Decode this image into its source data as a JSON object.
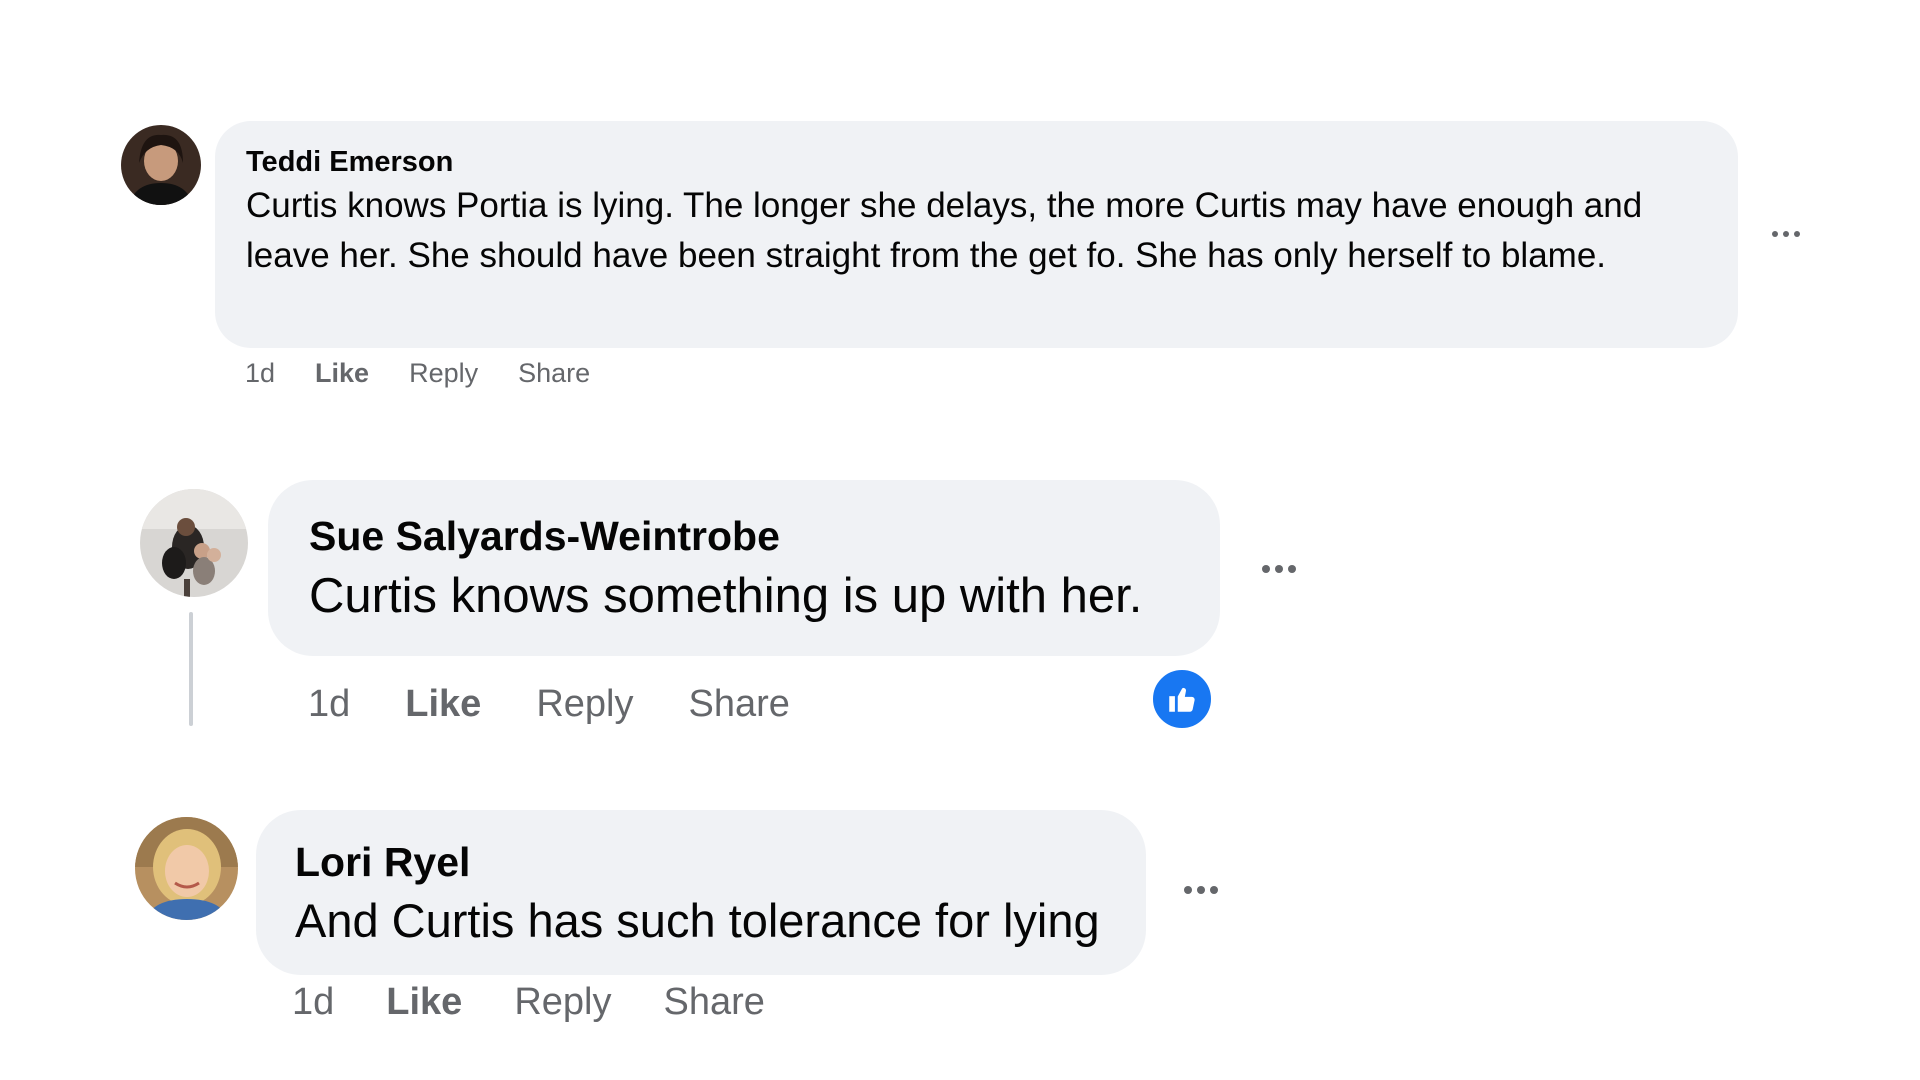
{
  "comments": [
    {
      "author": "Teddi Emerson",
      "text": "Curtis knows Portia is lying. The longer she delays, the more Curtis may have enough and leave her. She should have been straight from the get fo. She has only herself to blame.",
      "time": "1d",
      "like_label": "Like",
      "reply_label": "Reply",
      "share_label": "Share",
      "avatar_icon": "avatar-photo-icon",
      "more_icon": "more-options-icon"
    },
    {
      "author": "Sue Salyards-Weintrobe",
      "text": "Curtis knows something is up with her.",
      "time": "1d",
      "like_label": "Like",
      "reply_label": "Reply",
      "share_label": "Share",
      "avatar_icon": "avatar-photo-icon",
      "more_icon": "more-options-icon",
      "reaction_icon": "thumbs-up-icon"
    },
    {
      "author": "Lori Ryel",
      "text": "And Curtis has such tolerance for lying",
      "time": "1d",
      "like_label": "Like",
      "reply_label": "Reply",
      "share_label": "Share",
      "avatar_icon": "avatar-photo-icon",
      "more_icon": "more-options-icon"
    }
  ],
  "colors": {
    "bubble_background": "#f0f2f5",
    "secondary_text": "#65676b",
    "reaction_blue": "#1877f2"
  }
}
